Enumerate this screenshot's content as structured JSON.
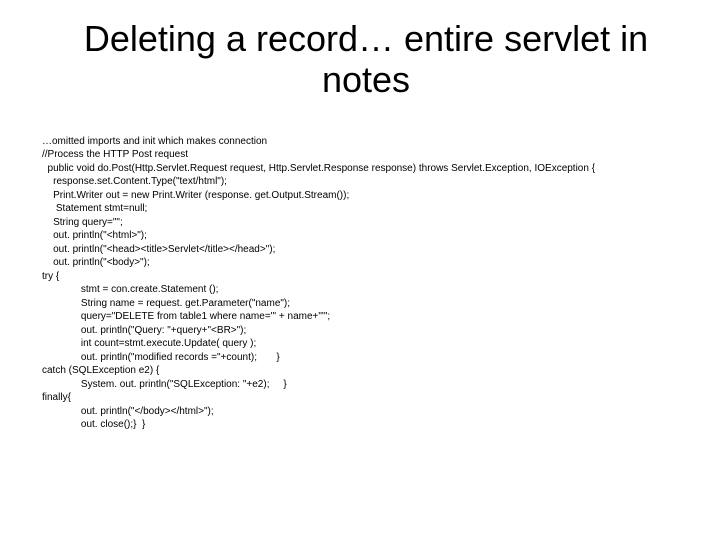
{
  "slide": {
    "title": "Deleting a record… entire servlet in notes",
    "code": "…omitted imports and init which makes connection\n//Process the HTTP Post request\n  public void do.Post(Http.Servlet.Request request, Http.Servlet.Response response) throws Servlet.Exception, IOException {\n    response.set.Content.Type(\"text/html\");\n    Print.Writer out = new Print.Writer (response. get.Output.Stream());\n     Statement stmt=null;\n    String query=\"\";\n    out. println(\"<html>\");\n    out. println(\"<head><title>Servlet</title></head>\");\n    out. println(\"<body>\");\ntry {\n              stmt = con.create.Statement ();\n              String name = request. get.Parameter(\"name\");\n              query=\"DELETE from table1 where name='\" + name+\"'\";\n              out. println(\"Query: \"+query+\"<BR>\");\n              int count=stmt.execute.Update( query );\n              out. println(\"modified records =\"+count);       }\ncatch (SQLException e2) {\n              System. out. println(\"SQLException: \"+e2);     }\nfinally{\n              out. println(\"</body></html>\");\n              out. close();}  }"
  }
}
